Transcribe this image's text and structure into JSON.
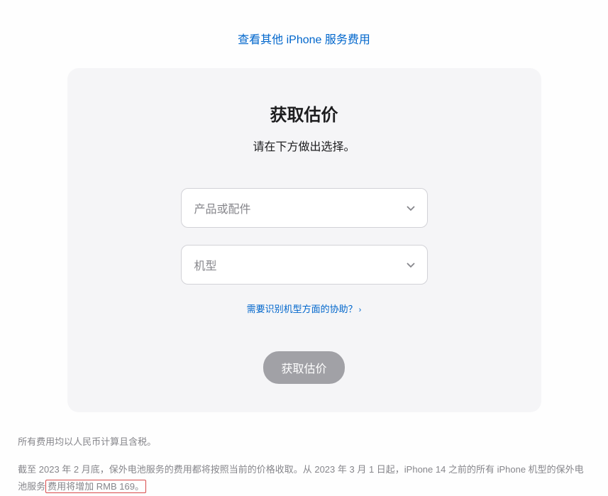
{
  "topLink": {
    "text": "查看其他 iPhone 服务费用"
  },
  "card": {
    "title": "获取估价",
    "subtitle": "请在下方做出选择。",
    "select1": {
      "placeholder": "产品或配件"
    },
    "select2": {
      "placeholder": "机型"
    },
    "helpLink": {
      "text": "需要识别机型方面的协助？"
    },
    "submitButton": {
      "label": "获取估价"
    }
  },
  "disclaimer": {
    "line1": "所有费用均以人民币计算且含税。",
    "line2_part1": "截至 2023 年 2 月底，保外电池服务的费用都将按照当前的价格收取。从 2023 年 3 月 1 日起，iPhone 14 之前的所有 iPhone 机型的保外电池服务",
    "line2_highlight": "费用将增加 RMB 169。"
  }
}
